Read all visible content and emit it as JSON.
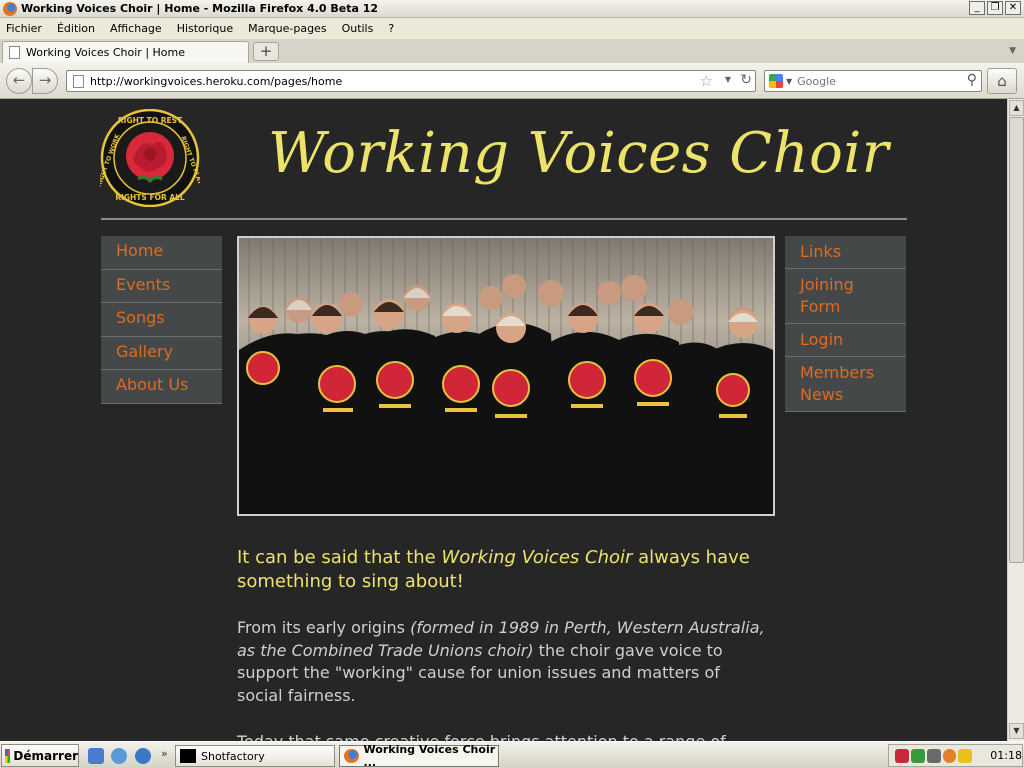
{
  "window": {
    "title": "Working Voices Choir | Home - Mozilla Firefox 4.0 Beta 12",
    "controls": [
      "_",
      "❐",
      "✕"
    ]
  },
  "menu": [
    "Fichier",
    "Édition",
    "Affichage",
    "Historique",
    "Marque-pages",
    "Outils",
    "?"
  ],
  "tabs": [
    {
      "label": "Working Voices Choir | Home"
    }
  ],
  "newtab_label": "+",
  "nav": {
    "url": "http://workingvoices.heroku.com/pages/home",
    "search_placeholder": "Google"
  },
  "site": {
    "logo_text_top": "RIGHT TO REST",
    "logo_text_left": "RIGHT TO WORK",
    "logo_text_right": "RIGHT TO PLAY",
    "logo_text_bottom": "RIGHTS FOR ALL",
    "title": "Working Voices Choir",
    "nav_left": [
      "Home",
      "Events",
      "Songs",
      "Gallery",
      "About Us"
    ],
    "nav_right": [
      "Links",
      "Joining Form",
      "Login",
      "Members News"
    ],
    "lead_part1": "It can be said that the ",
    "lead_em": "Working Voices Choir",
    "lead_part2": " always have something to sing about!",
    "body_part1": "From its early origins ",
    "body_em": "(formed in 1989 in Perth, Western Australia, as the Combined Trade Unions choir)",
    "body_part2": " the choir gave voice to support the \"working\" cause for union issues and matters of social fairness.",
    "body2": "Today that same creative force brings attention to a range of"
  },
  "taskbar": {
    "start_label": "Démarrer",
    "tasks": [
      {
        "label": "Shotfactory"
      },
      {
        "label": "Working Voices Choir ..."
      }
    ],
    "clock": "01:18"
  },
  "colors": {
    "page_bg": "#262626",
    "title_yellow": "#ece46a",
    "nav_orange": "#e06a20",
    "nav_bg": "#454848"
  }
}
